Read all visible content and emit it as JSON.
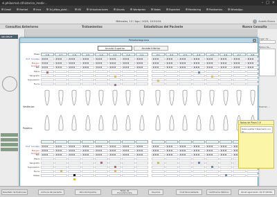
{
  "browser": {
    "url": "sl.philasmat.cl/historico_medic...",
    "bookmarks": [
      "Gmail",
      "Hamlet",
      "Inca",
      "3d_dtbra_plast...",
      "VIS",
      "Virtualizaciones",
      "Ubuntu",
      "Wordpress",
      "Notes",
      "Expected",
      "Monitoring",
      "Positromics",
      "WhatsApp"
    ]
  },
  "app": {
    "datetime": "Miércoles, 13 / Ago / 2025, 10:50:54",
    "user_name": "Andrés Rivera",
    "nav": [
      "Consultas Anteriores",
      "Tratamientos",
      "Estadísticas del Paciente",
      "Nueva Consulta"
    ],
    "left_tag": "ANI DELVE",
    "right_labels": [
      "Lugar de ...",
      "Motivo Pa..."
    ],
    "right_fields_extra": "Examen ..."
  },
  "modal": {
    "title": "Periodontograma",
    "tabs": [
      "Arcada Superior",
      "Arcada Inferior"
    ],
    "upper_header_label": "Pieza",
    "upper_teeth": [
      "1.8",
      "1.7",
      "1.6",
      "1.5",
      "1.4",
      "1.3",
      "1.2",
      "1.1",
      "2.1",
      "2.2",
      "2.3",
      "2.4",
      "2.5",
      "2.6",
      "2.7",
      "2.8"
    ],
    "upper_rows": [
      "Prof. Sondaje",
      "Margen Gingival",
      "NIC",
      "Placa",
      "Sangrado",
      "Supuración",
      "Furca"
    ],
    "labels_mid": [
      "Vestibular",
      "Palatino"
    ],
    "lower_rows": [
      "Prof. Sondaje",
      "Margen Gingival",
      "NIC",
      "Placa",
      "Sangrado",
      "Supuración",
      "Furca",
      "Notas"
    ],
    "lower_header_label": "Pieza"
  },
  "note": {
    "title": "Notas de Pieza 2.6",
    "text": "Debe realizar tratamiento con ch..."
  },
  "bottom": {
    "buttons": [
      "Resultado de Exámenes",
      "Archivos del paciente",
      "Periodontograma",
      "Notas de Procedimientos",
      "Usuarios",
      "Cirat Personalizada",
      "Certificados Médicos"
    ],
    "status": "Ghost agendado: 10:37:08 Ms"
  },
  "colors": {
    "accent": "#bcd6e3",
    "marker_red": "#e05a5a",
    "marker_yellow": "#f2c100",
    "marker_blue": "#5c8ad9"
  }
}
